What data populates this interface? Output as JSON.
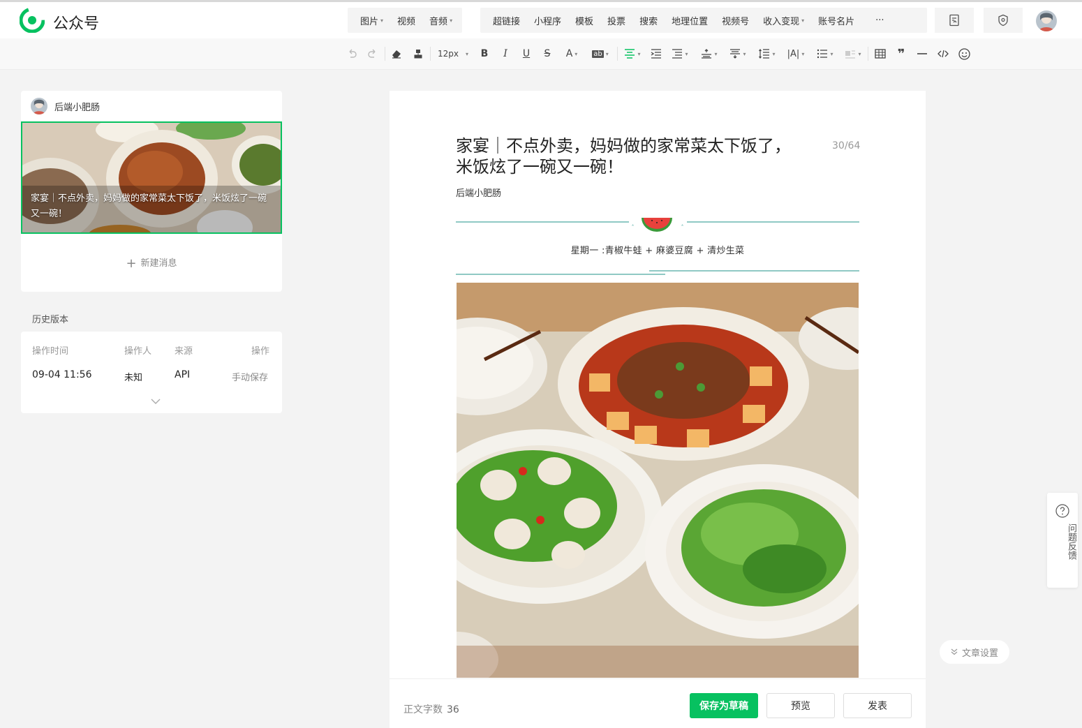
{
  "app": {
    "brand": "公众号",
    "accent": "#07c160"
  },
  "topbar": {
    "media": [
      {
        "label": "图片",
        "dropdown": true
      },
      {
        "label": "视频",
        "dropdown": false
      },
      {
        "label": "音频",
        "dropdown": true
      }
    ],
    "inserts": [
      {
        "label": "超链接",
        "dropdown": false
      },
      {
        "label": "小程序",
        "dropdown": false
      },
      {
        "label": "模板",
        "dropdown": false
      },
      {
        "label": "投票",
        "dropdown": false
      },
      {
        "label": "搜索",
        "dropdown": false
      },
      {
        "label": "地理位置",
        "dropdown": false
      },
      {
        "label": "视频号",
        "dropdown": false
      },
      {
        "label": "收入变现",
        "dropdown": true
      },
      {
        "label": "账号名片",
        "dropdown": false
      }
    ],
    "more": "···"
  },
  "toolbar": {
    "font_size": "12px"
  },
  "left": {
    "author": "后端小肥肠",
    "cover_title": "家宴｜不点外卖，妈妈做的家常菜太下饭了，米饭炫了一碗又一碗！",
    "new_message": "新建消息",
    "history_label": "历史版本",
    "history": {
      "headers": [
        "操作时间",
        "操作人",
        "来源",
        "操作"
      ],
      "rows": [
        [
          "09-04 11:56",
          "未知",
          "API",
          "手动保存"
        ]
      ]
    }
  },
  "editor": {
    "title": "家宴｜不点外卖，妈妈做的家常菜太下饭了，米饭炫了一碗又一碗！",
    "title_count": "30/64",
    "author": "后端小肥肠",
    "day_menu": "星期一 :青椒牛蛙 + 麻婆豆腐 + 清炒生菜"
  },
  "footer": {
    "word_count_label": "正文字数",
    "word_count": "36",
    "save_draft": "保存为草稿",
    "preview": "预览",
    "publish": "发表"
  },
  "side": {
    "feedback": "问题反馈",
    "article_settings": "文章设置"
  }
}
